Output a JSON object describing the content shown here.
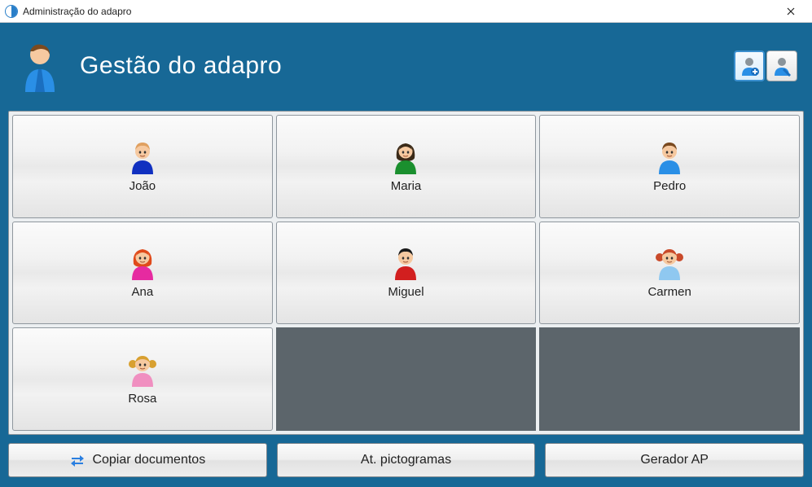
{
  "window": {
    "title": "Administração do adapro"
  },
  "header": {
    "title": "Gestão do adapro"
  },
  "toolbar": {
    "add_user_icon": "person-plus-icon",
    "edit_user_icon": "person-edit-icon"
  },
  "users": [
    {
      "name": "João",
      "hair": "#e0a060",
      "shirt": "#1030c0",
      "skin": "#f6c9a0",
      "style": "boy"
    },
    {
      "name": "Maria",
      "hair": "#3a2a18",
      "shirt": "#1a8f2e",
      "skin": "#f6c9a0",
      "style": "girl"
    },
    {
      "name": "Pedro",
      "hair": "#7a4a20",
      "shirt": "#2a8fe6",
      "skin": "#f6c9a0",
      "style": "boy"
    },
    {
      "name": "Ana",
      "hair": "#e04a1a",
      "shirt": "#e62aa0",
      "skin": "#f6c9a0",
      "style": "girl"
    },
    {
      "name": "Miguel",
      "hair": "#1a1a1a",
      "shirt": "#d21f1f",
      "skin": "#f6c9a0",
      "style": "boy"
    },
    {
      "name": "Carmen",
      "hair": "#c94a2a",
      "shirt": "#8fc8f0",
      "skin": "#f6c9a0",
      "style": "girl-pigtails"
    },
    {
      "name": "Rosa",
      "hair": "#d8a030",
      "shirt": "#f08fc0",
      "skin": "#f6c9a0",
      "style": "girl-pigtails"
    }
  ],
  "actions": {
    "copy_docs": "Copiar documentos",
    "update_pictos": "At. pictogramas",
    "gen_ap": "Gerador AP"
  }
}
